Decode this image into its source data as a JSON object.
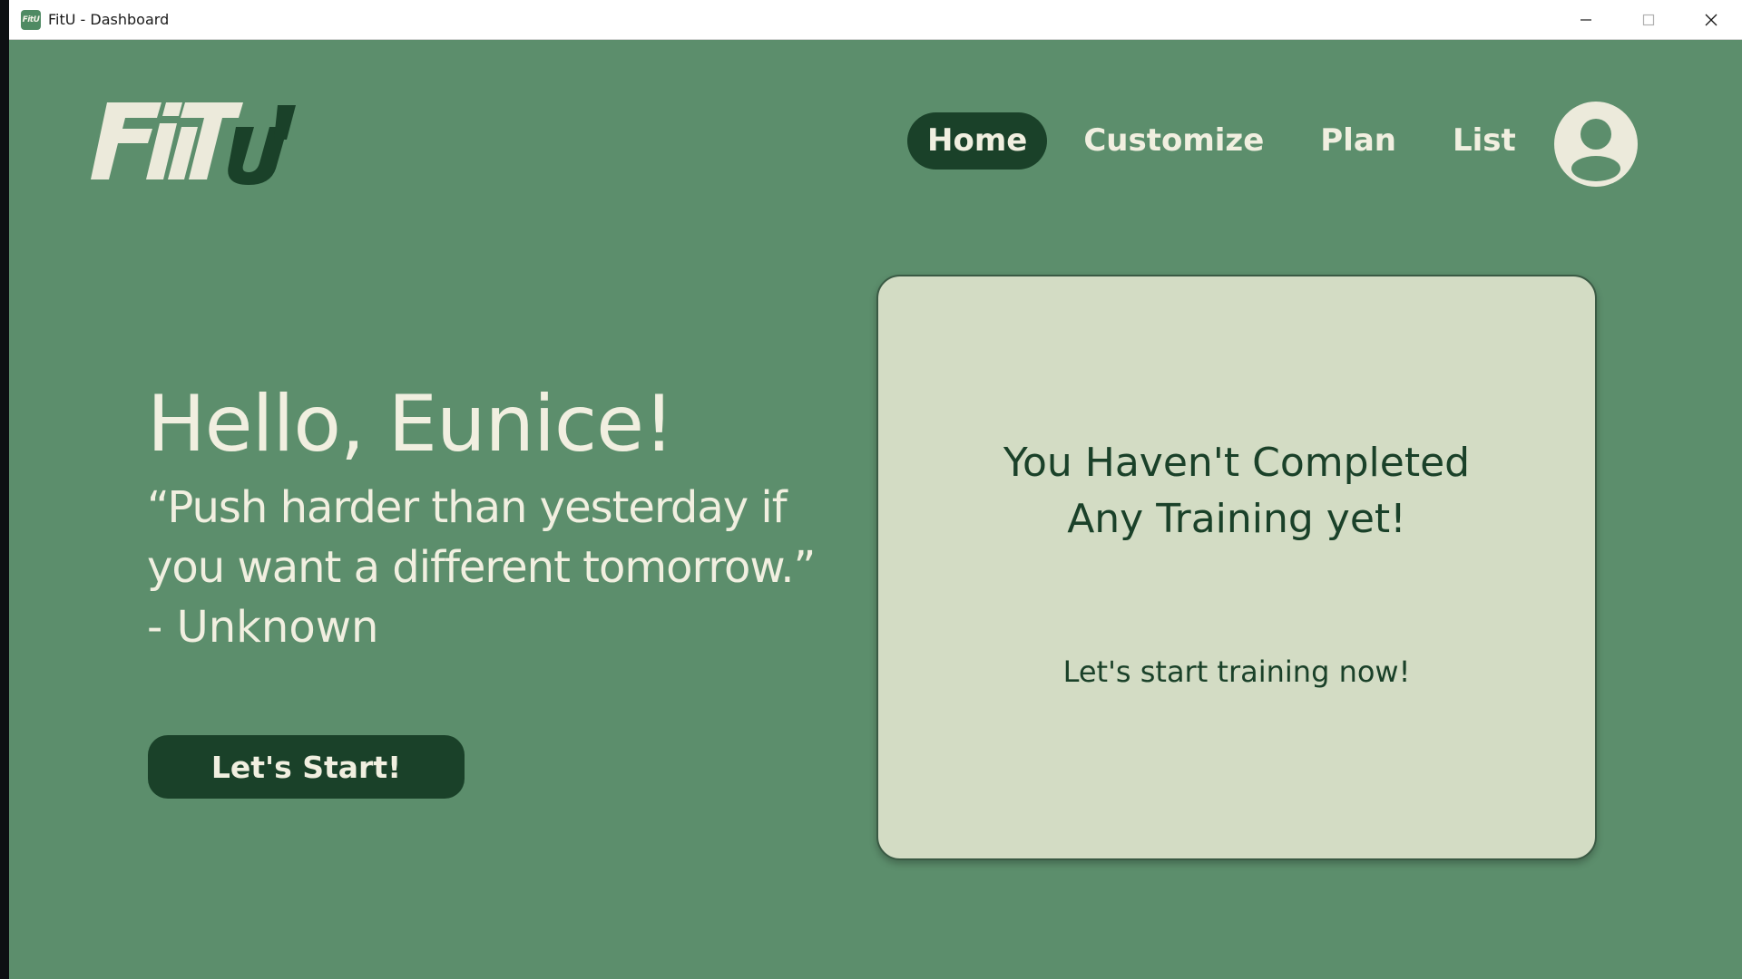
{
  "window": {
    "title": "FitU - Dashboard",
    "icon_text": "FitU"
  },
  "header": {
    "logo_text": "FitU",
    "nav": [
      {
        "label": "Home",
        "active": true
      },
      {
        "label": "Customize",
        "active": false
      },
      {
        "label": "Plan",
        "active": false
      },
      {
        "label": "List",
        "active": false
      }
    ],
    "avatar_icon": "user-avatar-icon"
  },
  "hero": {
    "greeting": "Hello, Eunice!",
    "quote": "“Push harder than yesterday if you want a different tomorrow.”",
    "author": "- Unknown",
    "start_label": "Let's Start!"
  },
  "status_card": {
    "title": "You Haven't Completed Any Training yet!",
    "subtitle": "Let's start training now!"
  },
  "colors": {
    "background": "#5c8e6c",
    "dark_green": "#1a4129",
    "cream": "#f1efe0",
    "card_bg": "#d3dcc4"
  }
}
